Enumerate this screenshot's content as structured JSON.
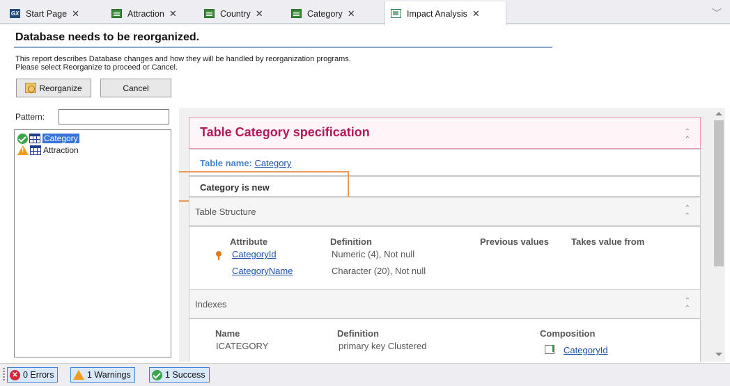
{
  "tabs": [
    {
      "label": "Start Page",
      "icon": "gx-icon",
      "active": false
    },
    {
      "label": "Attraction",
      "icon": "transaction-icon",
      "active": false
    },
    {
      "label": "Country",
      "icon": "transaction-icon",
      "active": false
    },
    {
      "label": "Category",
      "icon": "transaction-icon",
      "active": false
    },
    {
      "label": "Impact Analysis",
      "icon": "impact-analysis-icon",
      "active": true
    }
  ],
  "tab_close_glyph": "✕",
  "header": {
    "title": "Database needs to be reorganized.",
    "description_line1": "This report describes Database changes and how they will be handled by reorganization programs.",
    "description_line2": "Please select Reorganize to proceed or Cancel."
  },
  "buttons": {
    "reorganize": "Reorganize",
    "cancel": "Cancel"
  },
  "filter": {
    "pattern_label": "Pattern:",
    "pattern_value": ""
  },
  "tree": [
    {
      "label": "Category",
      "status": "success",
      "selected": true
    },
    {
      "label": "Attraction",
      "status": "warning",
      "selected": false
    }
  ],
  "report": {
    "spec_title": "Table Category specification",
    "table_name_label": "Table name:",
    "table_name_value": "Category",
    "new_message": "Category is new",
    "collapse_glyph": "⌃",
    "structure": {
      "label": "Table Structure",
      "headers": [
        "Attribute",
        "Definition",
        "Previous values",
        "Takes value from"
      ],
      "rows": [
        {
          "attribute": "CategoryId",
          "definition": "Numeric (4), Not null",
          "key": true
        },
        {
          "attribute": "CategoryName",
          "definition": "Character (20), Not null",
          "key": false
        }
      ]
    },
    "indexes": {
      "label": "Indexes",
      "headers": [
        "Name",
        "Definition",
        "Composition"
      ],
      "rows": [
        {
          "name": "ICATEGORY",
          "definition": "primary key Clustered",
          "composition": "CategoryId"
        }
      ]
    }
  },
  "statusbar": {
    "errors": "0 Errors",
    "warnings": "1 Warnings",
    "success": "1 Success"
  },
  "colors": {
    "accent_title": "#b3195a",
    "link": "#1d4fa8",
    "highlight_box": "#e79a5a"
  }
}
